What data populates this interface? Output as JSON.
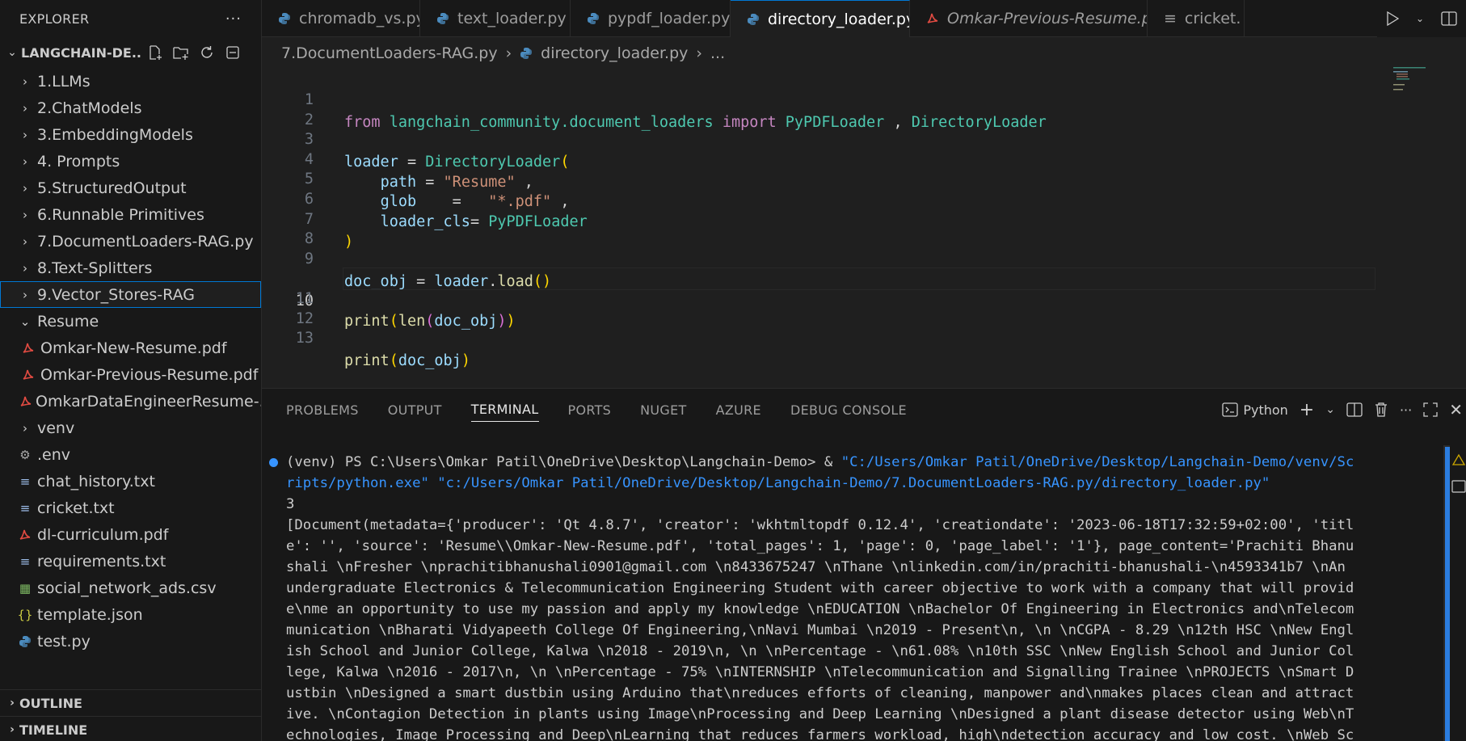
{
  "sidebar": {
    "title": "EXPLORER",
    "workspace": "LANGCHAIN-DE...",
    "items": [
      {
        "label": "1.LLMs",
        "type": "folder"
      },
      {
        "label": "2.ChatModels",
        "type": "folder"
      },
      {
        "label": "3.EmbeddingModels",
        "type": "folder"
      },
      {
        "label": "4. Prompts",
        "type": "folder"
      },
      {
        "label": "5.StructuredOutput",
        "type": "folder"
      },
      {
        "label": "6.Runnable Primitives",
        "type": "folder"
      },
      {
        "label": "7.DocumentLoaders-RAG.py",
        "type": "folder"
      },
      {
        "label": "8.Text-Splitters",
        "type": "folder"
      },
      {
        "label": "9.Vector_Stores-RAG",
        "type": "folder",
        "selected": true
      },
      {
        "label": "Resume",
        "type": "folder-open"
      },
      {
        "label": "Omkar-New-Resume.pdf",
        "type": "pdf"
      },
      {
        "label": "Omkar-Previous-Resume.pdf",
        "type": "pdf"
      },
      {
        "label": "OmkarDataEngineerResume-...",
        "type": "pdf"
      },
      {
        "label": "venv",
        "type": "folder"
      },
      {
        "label": ".env",
        "type": "env"
      },
      {
        "label": "chat_history.txt",
        "type": "txt"
      },
      {
        "label": "cricket.txt",
        "type": "txt"
      },
      {
        "label": "dl-curriculum.pdf",
        "type": "pdf"
      },
      {
        "label": "requirements.txt",
        "type": "txt"
      },
      {
        "label": "social_network_ads.csv",
        "type": "csv"
      },
      {
        "label": "template.json",
        "type": "json"
      },
      {
        "label": "test.py",
        "type": "py"
      }
    ],
    "outline": "OUTLINE",
    "timeline": "TIMELINE"
  },
  "tabs": [
    {
      "label": "chromadb_vs.py",
      "type": "py"
    },
    {
      "label": "text_loader.py",
      "type": "py"
    },
    {
      "label": "pypdf_loader.py",
      "type": "py"
    },
    {
      "label": "directory_loader.py",
      "type": "py",
      "active": true
    },
    {
      "label": "Omkar-Previous-Resume.pdf",
      "type": "pdf"
    },
    {
      "label": "cricket.",
      "type": "txt"
    }
  ],
  "breadcrumb": {
    "folder": "7.DocumentLoaders-RAG.py",
    "file": "directory_loader.py",
    "more": "..."
  },
  "editor": {
    "current_line": 10,
    "line_numbers": [
      "1",
      "2",
      "3",
      "4",
      "5",
      "6",
      "7",
      "8",
      "9",
      "10",
      "11",
      "12",
      "13"
    ]
  },
  "panel": {
    "tabs": [
      "PROBLEMS",
      "OUTPUT",
      "TERMINAL",
      "PORTS",
      "NUGET",
      "AZURE",
      "DEBUG CONSOLE"
    ],
    "active_tab": "TERMINAL",
    "shell": "Python",
    "terminal": {
      "prompt": "(venv) PS C:\\Users\\Omkar Patil\\OneDrive\\Desktop\\Langchain-Demo> & ",
      "cmd_path1": "\"C:/Users/Omkar Patil/OneDrive/Desktop/Langchain-Demo/venv/Sc",
      "cmd_path2": "ripts/python.exe\"",
      "cmd_path3": " \"c:/Users/Omkar Patil/OneDrive/Desktop/Langchain-Demo/7.DocumentLoaders-RAG.py/directory_loader.py\"",
      "output": [
        "3",
        "[Document(metadata={'producer': 'Qt 4.8.7', 'creator': 'wkhtmltopdf 0.12.4', 'creationdate': '2023-06-18T17:32:59+02:00', 'titl",
        "e': '', 'source': 'Resume\\\\Omkar-New-Resume.pdf', 'total_pages': 1, 'page': 0, 'page_label': '1'}, page_content='Prachiti Bhanu",
        "shali \\nFresher \\nprachitibhanushali0901@gmail.com \\n8433675247 \\nThane \\nlinkedin.com/in/prachiti-bhanushali-\\n4593341b7 \\nAn",
        "undergraduate Electronics & Telecommunication Engineering Student with career objective to work with a company that will provid",
        "e\\nme an opportunity to use my passion and apply my knowledge \\nEDUCATION \\nBachelor Of Engineering in Electronics and\\nTelecom",
        "munication \\nBharati Vidyapeeth College Of Engineering,\\nNavi Mumbai \\n2019 - Present\\n, \\n \\nCGPA - 8.29 \\n12th HSC \\nNew Engl",
        "ish School and Junior College, Kalwa \\n2018 - 2019\\n, \\n \\nPercentage - \\n61.08% \\n10th SSC \\nNew English School and Junior Col",
        "lege, Kalwa \\n2016 - 2017\\n, \\n \\nPercentage - 75% \\nINTERNSHIP \\nTelecommunication and Signalling Trainee \\nPROJECTS \\nSmart D",
        "ustbin \\nDesigned a smart dustbin using Arduino that\\nreduces efforts of cleaning, manpower and\\nmakes places clean and attract",
        "ive. \\nContagion Detection in plants using Image\\nProcessing and Deep Learning \\nDesigned a plant disease detector using Web\\nT",
        "echnologies, Image Processing and Deep\\nLearning that reduces farmers workload, high\\ndetection accuracy and low cost. \\nWeb Sc"
      ]
    }
  },
  "code": {
    "l1": {
      "k1": "from",
      "mod": "langchain_community.document_loaders",
      "k2": "import",
      "c1": "PyPDFLoader",
      "comma": " , ",
      "c2": "DirectoryLoader"
    },
    "l3": {
      "var": "loader",
      "eq": " = ",
      "cls": "DirectoryLoader",
      "paren": "("
    },
    "l4": {
      "kw": "path",
      "eq": " = ",
      "val": "\"Resume\"",
      "tail": " ,"
    },
    "l5": {
      "kw": "glob",
      "eq": "    =   ",
      "val": "\"*.pdf\"",
      "tail": " ,"
    },
    "l6": {
      "kw": "loader_cls",
      "eq": "= ",
      "val": "PyPDFLoader"
    },
    "l7": {
      "paren": ")"
    },
    "l9": {
      "var": "doc_obj",
      "eq": " = ",
      "obj": "loader",
      "dot": ".",
      "fn": "load",
      "p": "()"
    },
    "l11": {
      "fn1": "print",
      "p1": "(",
      "fn2": "len",
      "p2": "(",
      "arg": "doc_obj",
      "p3": ")",
      "p4": ")"
    },
    "l13": {
      "fn": "print",
      "p1": "(",
      "arg": "doc_obj",
      "p2": ")"
    }
  }
}
